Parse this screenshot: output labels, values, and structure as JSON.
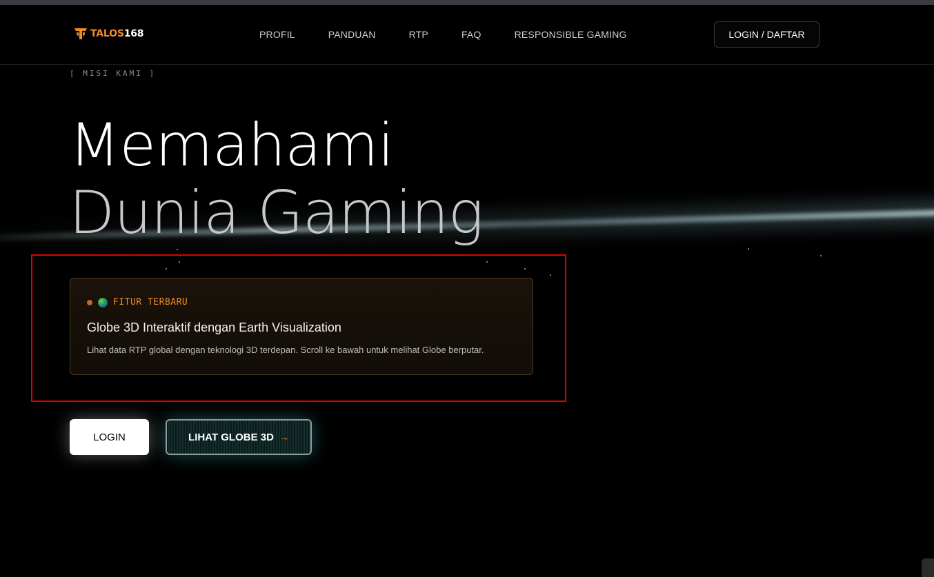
{
  "header": {
    "logo": {
      "brand_part1": "TALOS",
      "brand_part2": "168",
      "icon": "talos-logo-icon"
    },
    "nav": [
      "PROFIL",
      "PANDUAN",
      "RTP",
      "FAQ",
      "RESPONSIBLE GAMING"
    ],
    "login_daftar_label": "LOGIN / DAFTAR"
  },
  "hero": {
    "mission_label": "[ MISI KAMI ]",
    "title_line1": "Memahami",
    "title_line2": "Dunia Gaming"
  },
  "feature": {
    "tag": "FITUR TERBARU",
    "tag_icon": "globe-icon",
    "title": "Globe 3D Interaktif dengan Earth Visualization",
    "description": "Lihat data RTP global dengan teknologi 3D terdepan. Scroll ke bawah untuk melihat Globe berputar."
  },
  "buttons": {
    "login_label": "LOGIN",
    "globe_label": "LIHAT GLOBE 3D",
    "globe_arrow": "→"
  },
  "colors": {
    "accent": "#f28a24",
    "background": "#000000",
    "highlight_border": "#e00000"
  }
}
